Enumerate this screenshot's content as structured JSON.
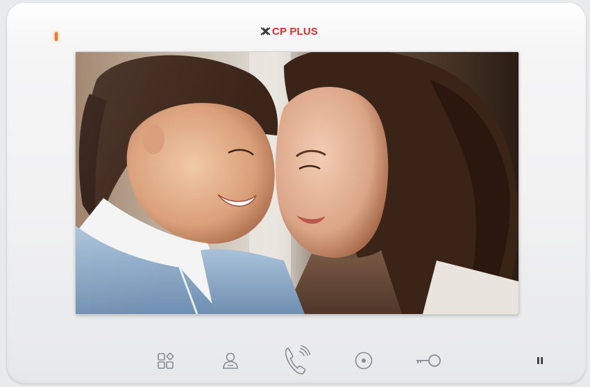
{
  "device": {
    "brand_name": "CP PLUS",
    "brand_color": "#e62a2a",
    "power_led_color": "#f07a1e"
  },
  "screen": {
    "image_description_icon": "live-camera-feed"
  },
  "buttons": [
    {
      "name": "menu",
      "icon": "menu-grid-icon"
    },
    {
      "name": "monitor",
      "icon": "person-icon"
    },
    {
      "name": "call",
      "icon": "phone-ring-icon"
    },
    {
      "name": "record",
      "icon": "record-icon"
    },
    {
      "name": "unlock",
      "icon": "key-icon"
    },
    {
      "name": "pause",
      "icon": "pause-icon"
    }
  ]
}
